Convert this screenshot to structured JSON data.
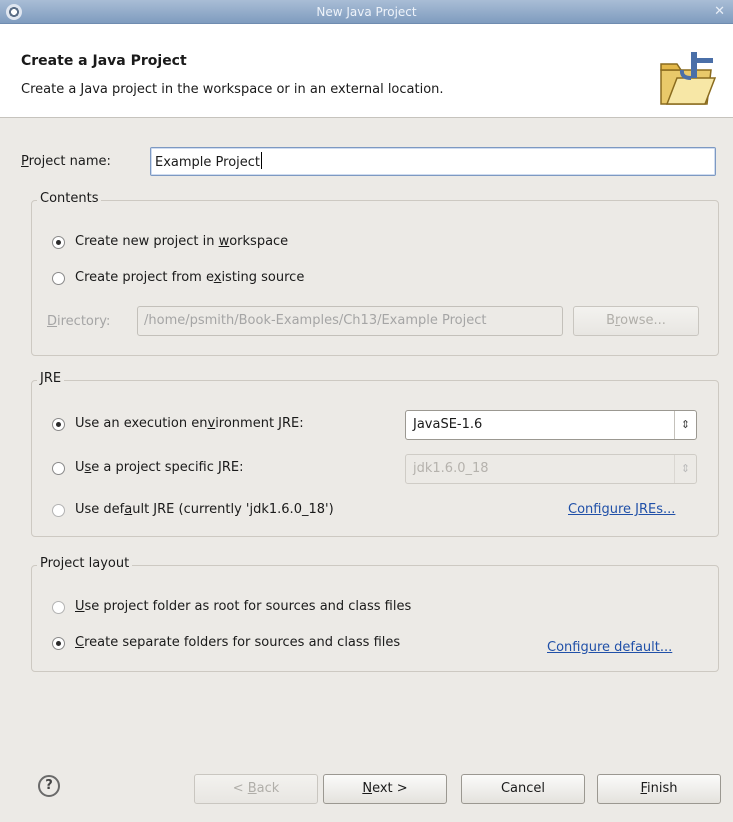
{
  "window": {
    "title": "New Java Project"
  },
  "header": {
    "title": "Create a Java Project",
    "description": "Create a Java project in the workspace or in an external location."
  },
  "project": {
    "name_label_u": "P",
    "name_label_rest": "roject name:",
    "name_value": "Example Project"
  },
  "contents": {
    "legend": "Contents",
    "opt1_a": "Create new project in ",
    "opt1_u": "w",
    "opt1_b": "orkspace",
    "opt2_a": "Create project from e",
    "opt2_u": "x",
    "opt2_b": "isting source",
    "dir_label_u": "D",
    "dir_label_rest": "irectory:",
    "dir_value": "/home/psmith/Book-Examples/Ch13/Example Project",
    "browse_a": "B",
    "browse_u": "r",
    "browse_b": "owse..."
  },
  "jre": {
    "legend": "JRE",
    "opt1_a": "Use an execution en",
    "opt1_u": "v",
    "opt1_b": "ironment JRE:",
    "opt1_value": "JavaSE-1.6",
    "opt2_a": "U",
    "opt2_u": "s",
    "opt2_b": "e a project specific JRE:",
    "opt2_value": "jdk1.6.0_18",
    "opt3_a": "Use def",
    "opt3_u": "a",
    "opt3_b": "ult JRE (currently 'jdk1.6.0_18')",
    "configure_link": "Configure JREs..."
  },
  "layout": {
    "legend": "Project layout",
    "opt1_u": "U",
    "opt1_b": "se project folder as root for sources and class files",
    "opt2_u": "C",
    "opt2_b": "reate separate folders for sources and class files",
    "configure_link": "Configure default..."
  },
  "footer": {
    "help": "?",
    "back_a": "< ",
    "back_u": "B",
    "back_b": "ack",
    "next_u": "N",
    "next_b": "ext >",
    "cancel": "Cancel",
    "finish_u": "F",
    "finish_b": "inish"
  },
  "icons": [
    "window-icon",
    "close-icon",
    "java-project-banner-icon",
    "combo-arrow-icon",
    "help-icon"
  ]
}
